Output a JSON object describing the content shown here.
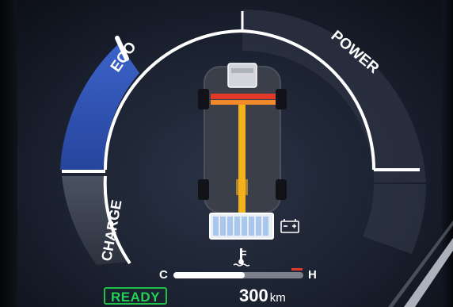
{
  "gauge": {
    "eco_label": "ECO",
    "power_label": "POWER",
    "charge_label": "CHARGE"
  },
  "status": {
    "ready_label": "READY"
  },
  "coolant": {
    "cold_label": "C",
    "hot_label": "H",
    "level_fraction": 0.55
  },
  "range": {
    "value": "300",
    "unit": "km"
  },
  "colors": {
    "eco_zone": "#2f55b8",
    "ready": "#22d254",
    "power_flow": "#f3b21c",
    "regen_axle": "#e23a2a",
    "battery_cells": "#a9c7ec"
  },
  "icons": {
    "battery_pack": "hybrid-battery-icon",
    "aux_battery": "auxiliary-battery-icon",
    "coolant_temp": "coolant-temperature-icon"
  }
}
